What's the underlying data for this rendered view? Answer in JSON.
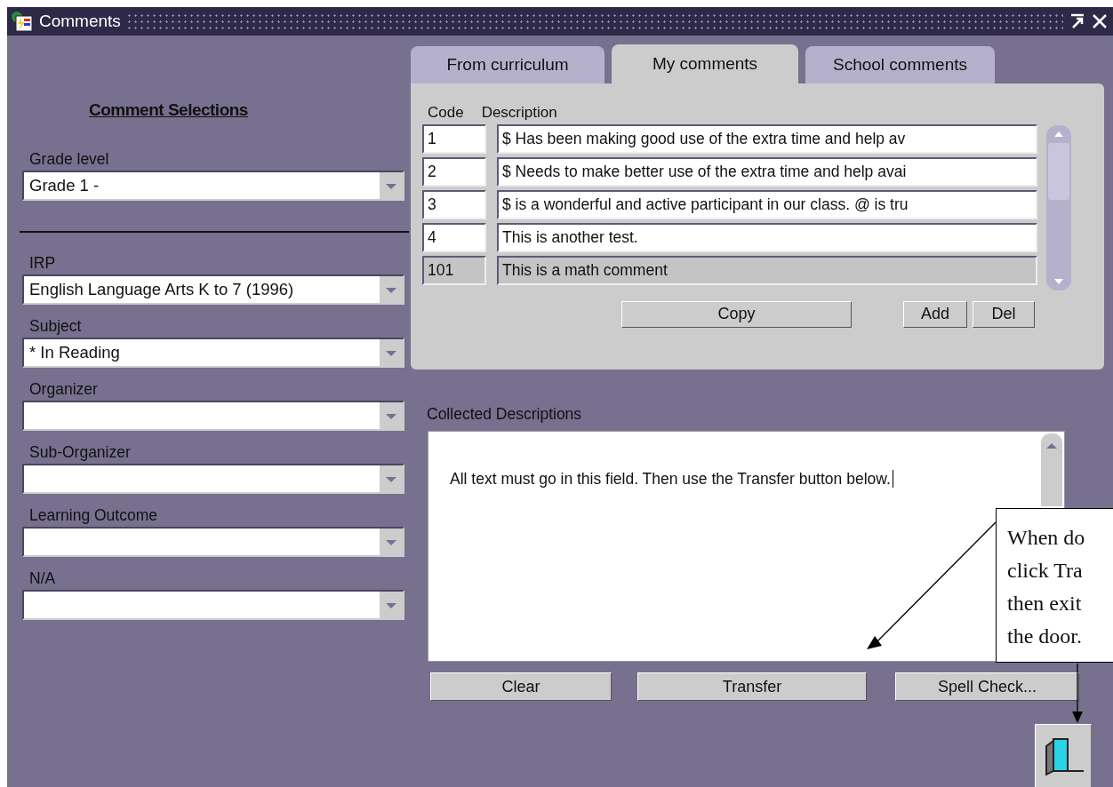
{
  "window": {
    "title": "Comments"
  },
  "selections": {
    "heading": "Comment Selections",
    "sections": [
      {
        "fields": [
          {
            "label": "Grade level",
            "value": "Grade 1 -"
          }
        ]
      },
      {
        "fields": [
          {
            "label": "IRP",
            "value": "English Language Arts K to 7 (1996)"
          },
          {
            "label": "Subject",
            "value": "* In Reading"
          },
          {
            "label": "Organizer"
          },
          {
            "label": "Sub-Organizer"
          },
          {
            "label": "Learning Outcome"
          },
          {
            "label": "N/A"
          }
        ]
      }
    ]
  },
  "tabs": [
    {
      "label": "From curriculum",
      "selected": false
    },
    {
      "label": "My comments",
      "selected": true
    },
    {
      "label": "School comments",
      "selected": false
    }
  ],
  "comments": {
    "columns": [
      "Code",
      "Description"
    ],
    "rows": [
      {
        "code": "1",
        "description": "$ Has been making good use of the extra time and help av",
        "selected": false
      },
      {
        "code": "2",
        "description": "$ Needs to make better use of the extra time and help avai",
        "selected": false
      },
      {
        "code": "3",
        "description": "$ is a wonderful and active participant in our class. @ is tru",
        "selected": false
      },
      {
        "code": "4",
        "description": "This is another test.",
        "selected": false
      },
      {
        "code": "101",
        "description": "This is a math comment",
        "selected": true
      }
    ],
    "buttons": [
      "Copy",
      "Add",
      "Del"
    ]
  },
  "collected": {
    "label": "Collected Descriptions",
    "value": "All text must go in this field. Then use the Transfer button below."
  },
  "buttons": [
    "Clear",
    "Transfer",
    "Spell Check..."
  ],
  "callout": {
    "lines": [
      "When do",
      "click Tra",
      "then exit",
      "the door."
    ]
  }
}
